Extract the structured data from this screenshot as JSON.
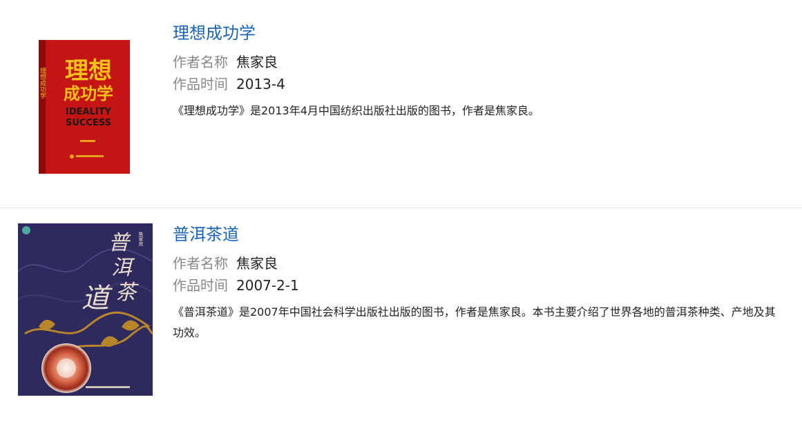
{
  "books": [
    {
      "title": "理想成功学",
      "author_label": "作者名称",
      "author": "焦家良",
      "date_label": "作品时间",
      "date": "2013-4",
      "description": "《理想成功学》是2013年4月中国纺织出版社出版的图书，作者是焦家良。",
      "cover": {
        "title_line1": "理想",
        "title_line2": "成功学",
        "en_line1": "IDEALITY",
        "en_line2": "SUCCESS",
        "spine_text": "理想成功学",
        "colors": {
          "background": "#c41414",
          "title": "#f5c21a",
          "en": "#1a1a1a"
        }
      }
    },
    {
      "title": "普洱茶道",
      "author_label": "作者名称",
      "author": "焦家良",
      "date_label": "作品时间",
      "date": "2007-2-1",
      "description": "《普洱茶道》是2007年中国社会科学出版社出版的图书，作者是焦家良。本书主要介绍了世界各地的普洱茶种类、产地及其功效。",
      "cover": {
        "title_chars": [
          "普",
          "洱",
          "茶",
          "道"
        ],
        "author_tag": "焦家良",
        "colors": {
          "background": "#2e2a5e",
          "title": "#e8dccd",
          "accent": "#b8862a"
        }
      }
    }
  ],
  "colors": {
    "title_link": "#1a64b8",
    "label": "#888888",
    "text": "#222222",
    "divider": "#e6e6e6"
  }
}
